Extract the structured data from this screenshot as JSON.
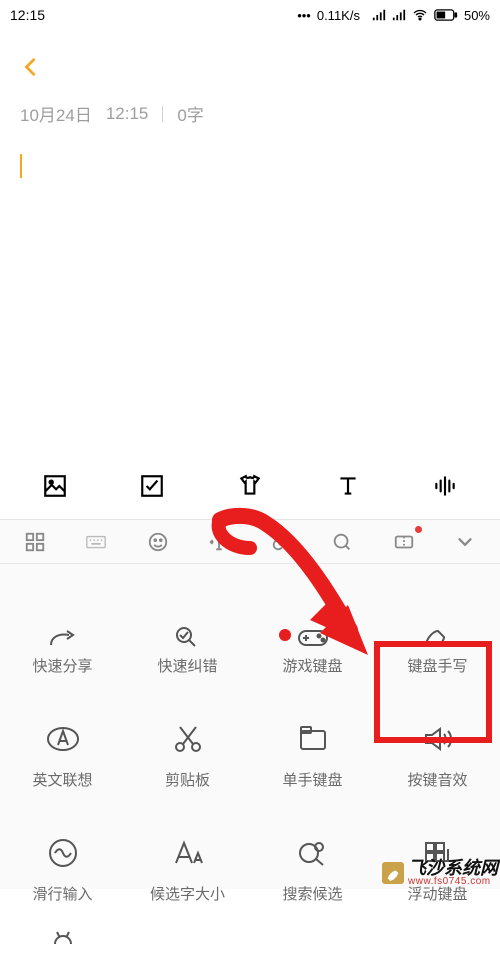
{
  "status": {
    "time": "12:15",
    "netspeed": "0.11K/s",
    "battery_pct": "50%"
  },
  "header": {
    "date": "10月24日",
    "time": "12:15",
    "word_count": "0字"
  },
  "kbd_tools": {
    "row1": [
      {
        "name": "quick-share",
        "label": "快速分享"
      },
      {
        "name": "quick-correct",
        "label": "快速纠错"
      },
      {
        "name": "game-kbd",
        "label": "游戏键盘"
      },
      {
        "name": "kbd-handwrite",
        "label": "键盘手写"
      }
    ],
    "row2": [
      {
        "name": "en-predict",
        "label": "英文联想"
      },
      {
        "name": "clipboard",
        "label": "剪贴板"
      },
      {
        "name": "one-hand",
        "label": "单手键盘"
      },
      {
        "name": "key-sound",
        "label": "按键音效"
      }
    ],
    "row3": [
      {
        "name": "swipe-input",
        "label": "滑行输入"
      },
      {
        "name": "cand-size",
        "label": "候选字大小"
      },
      {
        "name": "search-cand",
        "label": "搜索候选"
      },
      {
        "name": "float-kbd",
        "label": "浮动键盘"
      }
    ]
  },
  "annotations": {
    "highlight_target": "key-sound"
  },
  "watermark": {
    "title": "飞沙系统网",
    "sub": "www.fs0745.com"
  }
}
